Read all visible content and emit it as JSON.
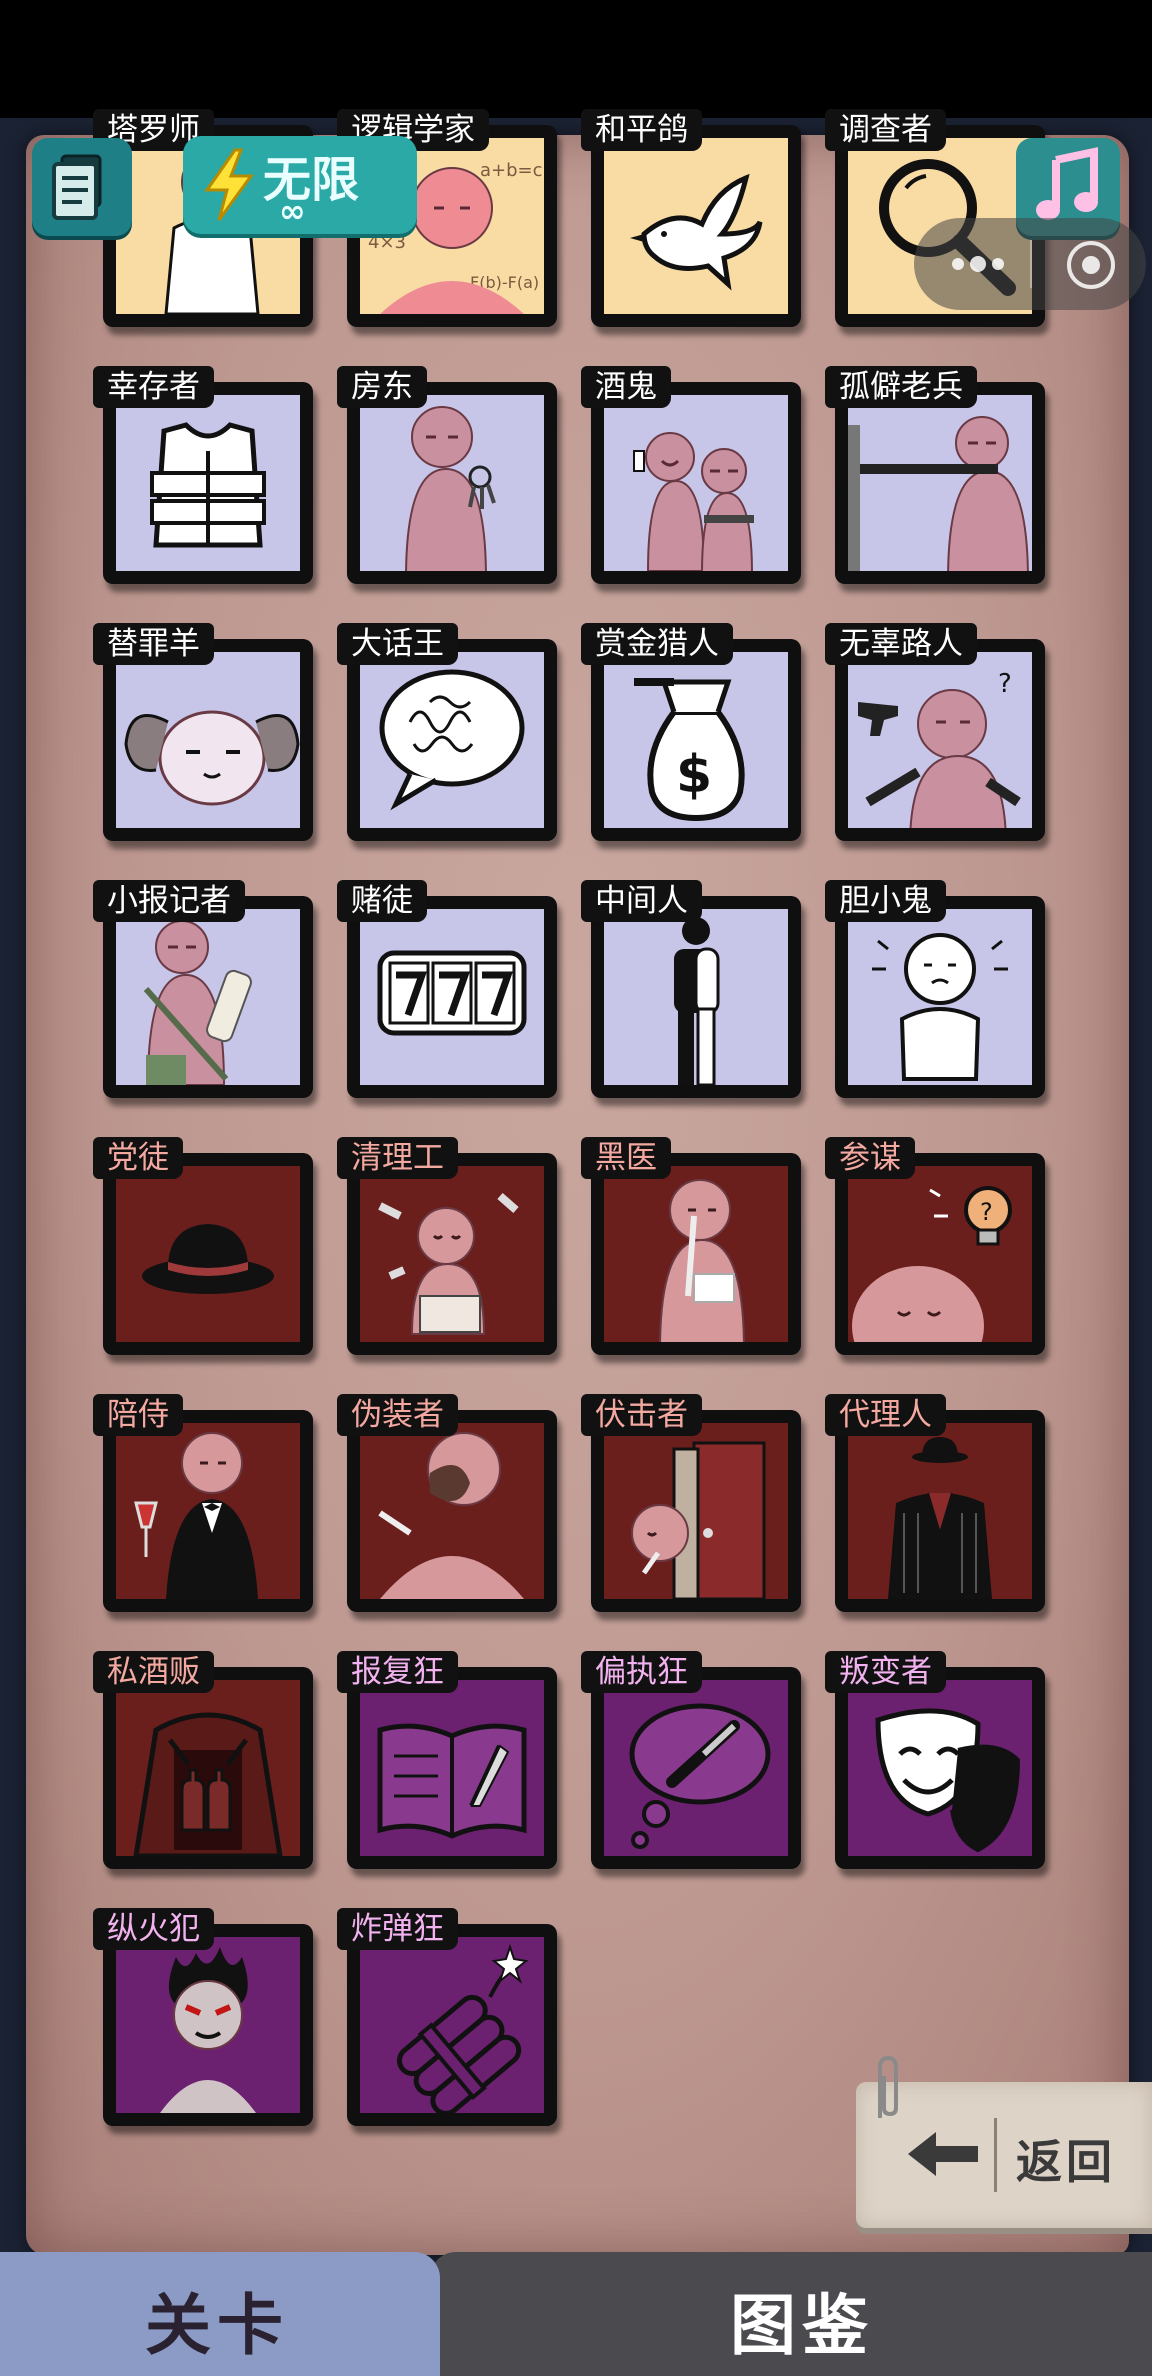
{
  "hud": {
    "energy_label": "无限",
    "energy_sub": "∞"
  },
  "cards": [
    {
      "id": "r0c0",
      "label": "塔罗师",
      "color": "yellow",
      "icon": "tarot-person"
    },
    {
      "id": "r0c1",
      "label": "逻辑学家",
      "color": "yellow",
      "icon": "math-person"
    },
    {
      "id": "r0c2",
      "label": "和平鸽",
      "color": "yellow",
      "icon": "dove"
    },
    {
      "id": "r0c3",
      "label": "调查者",
      "color": "yellow",
      "icon": "magnifier"
    },
    {
      "id": "r1c0",
      "label": "幸存者",
      "color": "lavender",
      "icon": "vest"
    },
    {
      "id": "r1c1",
      "label": "房东",
      "color": "lavender",
      "icon": "keys-person"
    },
    {
      "id": "r1c2",
      "label": "酒鬼",
      "color": "lavender",
      "icon": "drunks"
    },
    {
      "id": "r1c3",
      "label": "孤僻老兵",
      "color": "lavender",
      "icon": "rifle-person"
    },
    {
      "id": "r2c0",
      "label": "替罪羊",
      "color": "lavender",
      "icon": "goat"
    },
    {
      "id": "r2c1",
      "label": "大话王",
      "color": "lavender",
      "icon": "speech-bubble"
    },
    {
      "id": "r2c2",
      "label": "赏金猎人",
      "color": "lavender",
      "icon": "money-bag"
    },
    {
      "id": "r2c3",
      "label": "无辜路人",
      "color": "lavender",
      "icon": "guns-person"
    },
    {
      "id": "r3c0",
      "label": "小报记者",
      "color": "lavender",
      "icon": "reporter"
    },
    {
      "id": "r3c1",
      "label": "赌徒",
      "color": "lavender",
      "icon": "slot-777"
    },
    {
      "id": "r3c2",
      "label": "中间人",
      "color": "lavender",
      "icon": "standing-man"
    },
    {
      "id": "r3c3",
      "label": "胆小鬼",
      "color": "lavender",
      "icon": "scared-face"
    },
    {
      "id": "r4c0",
      "label": "党徒",
      "color": "red",
      "icon": "fedora"
    },
    {
      "id": "r4c1",
      "label": "清理工",
      "color": "red",
      "icon": "cleaner"
    },
    {
      "id": "r4c2",
      "label": "黑医",
      "color": "red",
      "icon": "doctor"
    },
    {
      "id": "r4c3",
      "label": "参谋",
      "color": "red",
      "icon": "idea-bulb"
    },
    {
      "id": "r5c0",
      "label": "陪侍",
      "color": "red",
      "icon": "waiter"
    },
    {
      "id": "r5c1",
      "label": "伪装者",
      "color": "red",
      "icon": "mask-person"
    },
    {
      "id": "r5c2",
      "label": "伏击者",
      "color": "red",
      "icon": "door-ambush"
    },
    {
      "id": "r5c3",
      "label": "代理人",
      "color": "red",
      "icon": "suit"
    },
    {
      "id": "r6c0",
      "label": "私酒贩",
      "color": "red",
      "icon": "coat-bottles"
    },
    {
      "id": "r6c1",
      "label": "报复狂",
      "color": "purple",
      "icon": "book-knife"
    },
    {
      "id": "r6c2",
      "label": "偏执狂",
      "color": "purple",
      "icon": "thought-knife"
    },
    {
      "id": "r6c3",
      "label": "叛变者",
      "color": "purple",
      "icon": "theatre-masks"
    },
    {
      "id": "r7c0",
      "label": "纵火犯",
      "color": "purple",
      "icon": "flame-person"
    },
    {
      "id": "r7c1",
      "label": "炸弹狂",
      "color": "purple",
      "icon": "dynamite"
    }
  ],
  "back_button": {
    "label": "返回"
  },
  "tabs": [
    {
      "label": "关卡",
      "active": false
    },
    {
      "label": "图鉴",
      "active": true
    }
  ],
  "colors": {
    "yellow": "#f8dca3",
    "lavender": "#c7c5e8",
    "red": "#6b1f1d",
    "purple": "#6b2170"
  }
}
